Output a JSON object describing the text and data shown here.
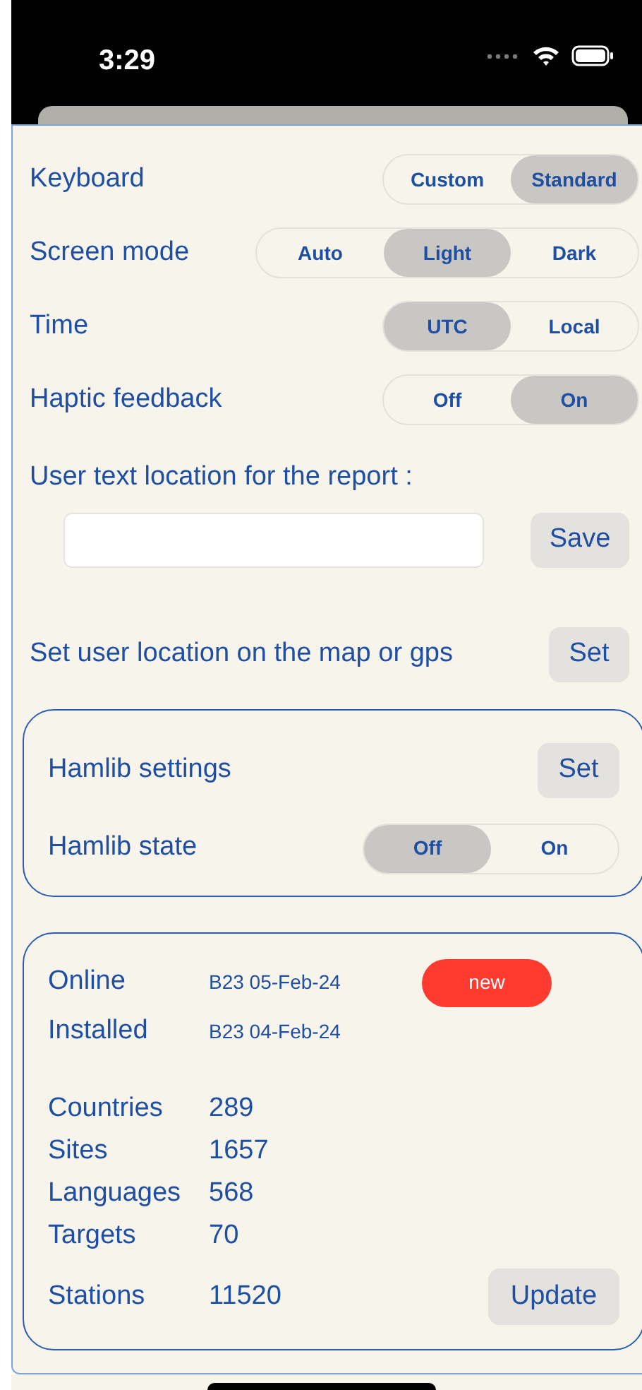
{
  "status_bar": {
    "time": "3:29"
  },
  "settings": [
    {
      "kind": "segmented",
      "label": "Keyboard",
      "options": [
        {
          "label": "Custom",
          "selected": false
        },
        {
          "label": "Standard",
          "selected": true
        }
      ]
    },
    {
      "kind": "segmented",
      "label": "Screen mode",
      "options": [
        {
          "label": "Auto",
          "selected": false
        },
        {
          "label": "Light",
          "selected": true
        },
        {
          "label": "Dark",
          "selected": false
        }
      ]
    },
    {
      "kind": "segmented",
      "label": "Time",
      "options": [
        {
          "label": "UTC",
          "selected": true
        },
        {
          "label": "Local",
          "selected": false
        }
      ]
    },
    {
      "kind": "segmented",
      "label": "Haptic feedback",
      "options": [
        {
          "label": "Off",
          "selected": false
        },
        {
          "label": "On",
          "selected": true
        }
      ]
    }
  ],
  "report_location": {
    "label": "User text location for the report :",
    "button": "Save"
  },
  "user_location": {
    "label": "Set user location on the map or gps",
    "button": "Set"
  },
  "hamlib": [
    {
      "kind": "button",
      "label": "Hamlib settings",
      "button": "Set"
    },
    {
      "kind": "segmented",
      "label": "Hamlib state",
      "options": [
        {
          "label": "Off",
          "selected": true
        },
        {
          "label": "On",
          "selected": false
        }
      ]
    }
  ],
  "database": {
    "online": {
      "label": "Online",
      "value": "B23 05-Feb-24",
      "badge": "new"
    },
    "installed": {
      "label": "Installed",
      "value": "B23 04-Feb-24"
    },
    "stats": [
      {
        "label": "Countries",
        "value": "289"
      },
      {
        "label": "Sites",
        "value": "1657"
      },
      {
        "label": "Languages",
        "value": "568"
      },
      {
        "label": "Targets",
        "value": "70"
      },
      {
        "label": "Stations",
        "value": "11520"
      }
    ],
    "button": "Update"
  }
}
